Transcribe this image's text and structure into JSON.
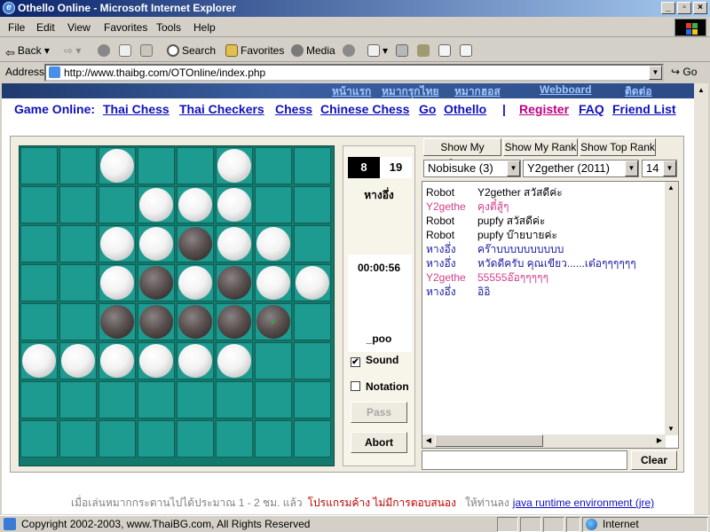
{
  "window": {
    "title": "Othello Online - Microsoft Internet Explorer"
  },
  "menu": [
    "File",
    "Edit",
    "View",
    "Favorites",
    "Tools",
    "Help"
  ],
  "toolbar": {
    "back": "Back",
    "search": "Search",
    "favorites": "Favorites",
    "media": "Media"
  },
  "address": {
    "label": "Address",
    "url": "http://www.thaibg.com/OTOnline/index.php",
    "go": "Go"
  },
  "banner_nav": [
    "หน้าแรก",
    "หมากรุกไทย",
    "หมากฮอส",
    "Webboard",
    "ติดต่อ"
  ],
  "links": {
    "label": "Game Online:",
    "games": [
      "Thai Chess",
      "Thai Checkers",
      "Chess",
      "Chinese Chess",
      "Go",
      "Othello"
    ],
    "separator": "|",
    "account": [
      "Register",
      "FAQ",
      "Friend List"
    ]
  },
  "board": {
    "size": 8,
    "last_move": [
      4,
      6
    ],
    "grid": [
      [
        "",
        "",
        "W",
        "",
        "",
        "W",
        "",
        ""
      ],
      [
        "",
        "",
        "",
        "W",
        "W",
        "W",
        "",
        ""
      ],
      [
        "",
        "",
        "W",
        "W",
        "B",
        "W",
        "W",
        ""
      ],
      [
        "",
        "",
        "W",
        "B",
        "W",
        "B",
        "W",
        "W"
      ],
      [
        "",
        "",
        "B",
        "B",
        "B",
        "B",
        "B",
        ""
      ],
      [
        "W",
        "W",
        "W",
        "W",
        "W",
        "W",
        "",
        ""
      ],
      [
        "",
        "",
        "",
        "",
        "",
        "",
        "",
        ""
      ],
      [
        "",
        "",
        "",
        "",
        "",
        "",
        "",
        ""
      ]
    ]
  },
  "game": {
    "score_black": "8",
    "score_white": "19",
    "player_top": "หางอึ่ง",
    "timer": "00:00:56",
    "player_bottom": "_poo",
    "sound_label": "Sound",
    "sound_checked": "✔",
    "notation_label": "Notation",
    "pass_label": "Pass",
    "abort_label": "Abort"
  },
  "side": {
    "buttons": [
      "Show My Status",
      "Show My Rank",
      "Show Top Rank"
    ],
    "select_player": "Nobisuke (3)",
    "select_opponent": "Y2gether (2011)",
    "select_size": "14",
    "chat": [
      {
        "who": "Robot",
        "msg": "Y2gether สวัสดีค่ะ",
        "color": "#000000"
      },
      {
        "who": "Y2gethe",
        "msg": "คุงตี๋สู้ๆ",
        "color": "#d0408a"
      },
      {
        "who": "Robot",
        "msg": "pupfy สวัสดีค่ะ",
        "color": "#000000"
      },
      {
        "who": "Robot",
        "msg": "pupfy บ๊ายบายค่ะ",
        "color": "#000000"
      },
      {
        "who": "หางอึ่ง",
        "msg": "คร๊าบบบบบบบบบบ",
        "color": "#1a1aa0"
      },
      {
        "who": "หางอึ่ง",
        "msg": "หวัดดีครับ คุณเขียว......เต๋อๆๆๆๆๆๆ",
        "color": "#1a1aa0"
      },
      {
        "who": "Y2gethe",
        "msg": "55555อ๊อๆๆๆๆๆ",
        "color": "#d0408a"
      },
      {
        "who": "หางอึ่ง",
        "msg": "อิอิ",
        "color": "#1a1aa0"
      }
    ],
    "clear_label": "Clear"
  },
  "note": {
    "part1": "เมื่อเล่นหมากกระดานไปได้ประมาณ 1 - 2 ชม. แล้ว",
    "part2": "โปรแกรมค้าง ไม่มีการตอบสนอง",
    "part3": "ให้ท่านลง",
    "link": "java runtime environment (jre)"
  },
  "status": {
    "text": "Copyright 2002-2003, www.ThaiBG.com, All Rights Reserved",
    "zone": "Internet"
  }
}
